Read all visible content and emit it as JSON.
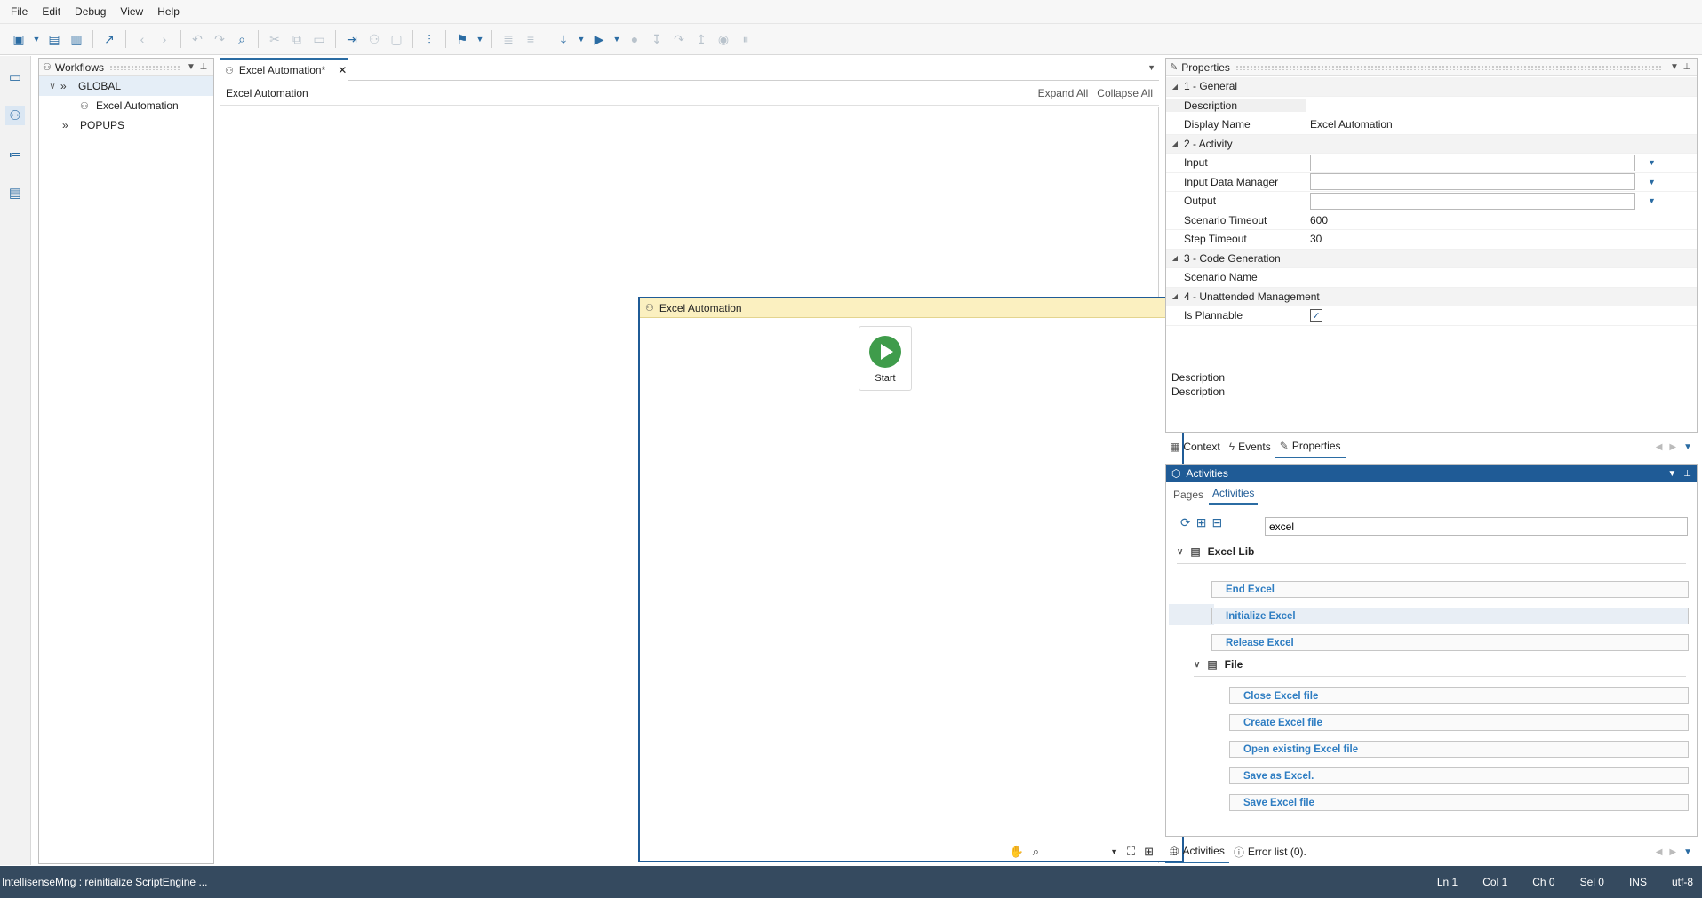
{
  "menu": [
    "File",
    "Edit",
    "Debug",
    "View",
    "Help"
  ],
  "workflows": {
    "title": "Workflows",
    "tree": [
      {
        "label": "GLOBAL"
      },
      {
        "label": "Excel Automation"
      },
      {
        "label": "POPUPS"
      }
    ]
  },
  "document": {
    "tab_label": "Excel Automation*",
    "breadcrumb": "Excel Automation",
    "expand_all": "Expand All",
    "collapse_all": "Collapse All",
    "sequence_title": "Excel Automation",
    "start_label": "Start"
  },
  "properties": {
    "title": "Properties",
    "cat_general": "1 - General",
    "cat_activity": "2 - Activity",
    "cat_code": "3 - Code Generation",
    "cat_unattended": "4 - Unattended Management",
    "description_label": "Description",
    "display_name_label": "Display Name",
    "display_name_value": "Excel Automation",
    "input_label": "Input",
    "input_dm_label": "Input Data Manager",
    "output_label": "Output",
    "scenario_timeout_label": "Scenario Timeout",
    "scenario_timeout_value": "600",
    "step_timeout_label": "Step Timeout",
    "step_timeout_value": "30",
    "scenario_name_label": "Scenario Name",
    "is_plannable_label": "Is Plannable",
    "is_plannable_checked": true,
    "desc_title": "Description",
    "desc_text": "Description"
  },
  "prop_tabs": [
    "Context",
    "Events",
    "Properties"
  ],
  "activities": {
    "title": "Activities",
    "subtabs": [
      "Pages",
      "Activities"
    ],
    "search_value": "excel",
    "group_excel": "Excel Lib",
    "excel_items": [
      "End Excel",
      "Initialize Excel",
      "Release Excel"
    ],
    "group_file": "File",
    "file_items": [
      "Close Excel file",
      "Create Excel file",
      "Open existing Excel file",
      "Save as Excel.",
      "Save Excel file"
    ]
  },
  "bottom_tabs": [
    "Activities",
    "Error list (0)."
  ],
  "status": {
    "message": "IntellisenseMng : reinitialize ScriptEngine ...",
    "ln": "Ln 1",
    "col": "Col 1",
    "ch": "Ch 0",
    "sel": "Sel 0",
    "ins": "INS",
    "enc": "utf-8"
  }
}
